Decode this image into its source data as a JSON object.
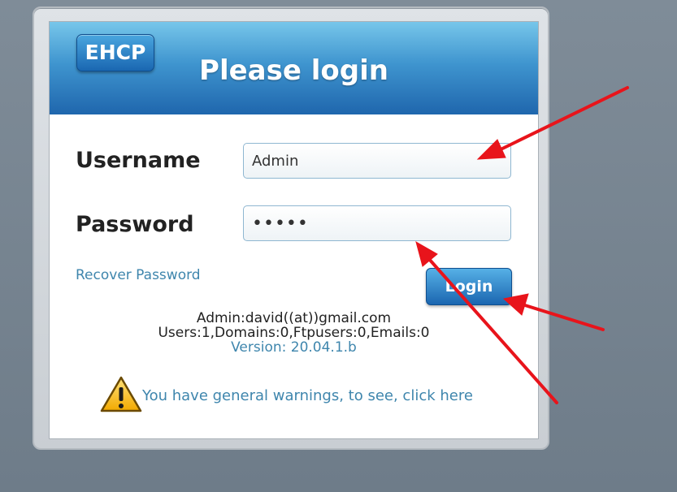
{
  "header": {
    "logo_text": "EHCP",
    "title": "Please login"
  },
  "form": {
    "username_label": "Username",
    "username_value": "Admin",
    "password_label": "Password",
    "password_value": "•••••",
    "recover_link": "Recover Password",
    "login_button": "Login"
  },
  "info": {
    "admin_contact": "Admin:david((at))gmail.com",
    "stats": "Users:1,Domains:0,Ftpusers:0,Emails:0",
    "version": "Version: 20.04.1.b"
  },
  "warning": {
    "icon": "warning-triangle-icon",
    "text": "You have general warnings, to see, click here"
  },
  "colors": {
    "accent_blue": "#1f66ad",
    "link": "#3f86ad",
    "annotation_arrow": "#e8141b"
  }
}
